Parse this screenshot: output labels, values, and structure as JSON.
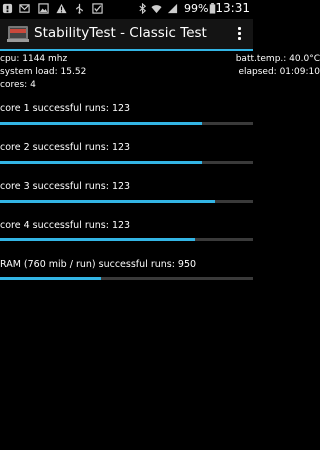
{
  "status_bar": {
    "battery_percent": "99%",
    "time": "13:31"
  },
  "action_bar": {
    "title": "StabilityTest - Classic Test",
    "accent_color": "#33b5e5"
  },
  "info": {
    "cpu": "cpu: 1144 mhz",
    "batt_temp": "batt.temp.: 40.0°C",
    "system_load": "system load: 15.52",
    "elapsed": "elapsed: 01:09:10",
    "cores": "cores: 4"
  },
  "tests": [
    {
      "label": "core 1 successful runs: 123",
      "progress_percent": 80
    },
    {
      "label": "core 2 successful runs: 123",
      "progress_percent": 80
    },
    {
      "label": "core 3 successful runs: 123",
      "progress_percent": 85
    },
    {
      "label": "core 4 successful runs: 123",
      "progress_percent": 77
    },
    {
      "label": "RAM (760 mib / run) successful runs: 950",
      "progress_percent": 40
    }
  ]
}
